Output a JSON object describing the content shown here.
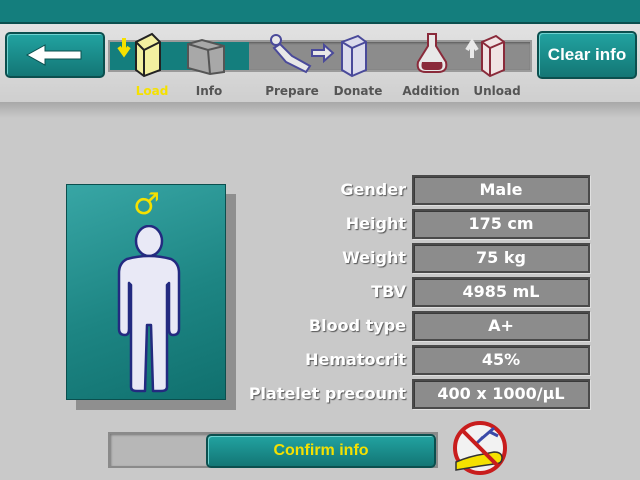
{
  "toolbar": {
    "clear_label": "Clear info",
    "steps": [
      {
        "label": "Load",
        "active": true
      },
      {
        "label": "Info",
        "active": false
      },
      {
        "label": "Prepare",
        "active": false
      },
      {
        "label": "Donate",
        "active": false
      },
      {
        "label": "Addition",
        "active": false
      },
      {
        "label": "Unload",
        "active": false
      }
    ],
    "progress_fraction": 0.33
  },
  "donor": {
    "gender_symbol": "♂",
    "fields": [
      {
        "label": "Gender",
        "value": "Male"
      },
      {
        "label": "Height",
        "value": "175 cm"
      },
      {
        "label": "Weight",
        "value": "75 kg"
      },
      {
        "label": "TBV",
        "value": "4985 mL"
      },
      {
        "label": "Blood type",
        "value": "A+"
      },
      {
        "label": "Hematocrit",
        "value": "45%"
      },
      {
        "label": "Platelet precount",
        "value": "400 x 1000/µL"
      }
    ]
  },
  "footer": {
    "confirm_label": "Confirm info"
  },
  "colors": {
    "accent_teal": "#147e7d",
    "active_step": "#f5e100",
    "background": "#c9c9c9"
  }
}
